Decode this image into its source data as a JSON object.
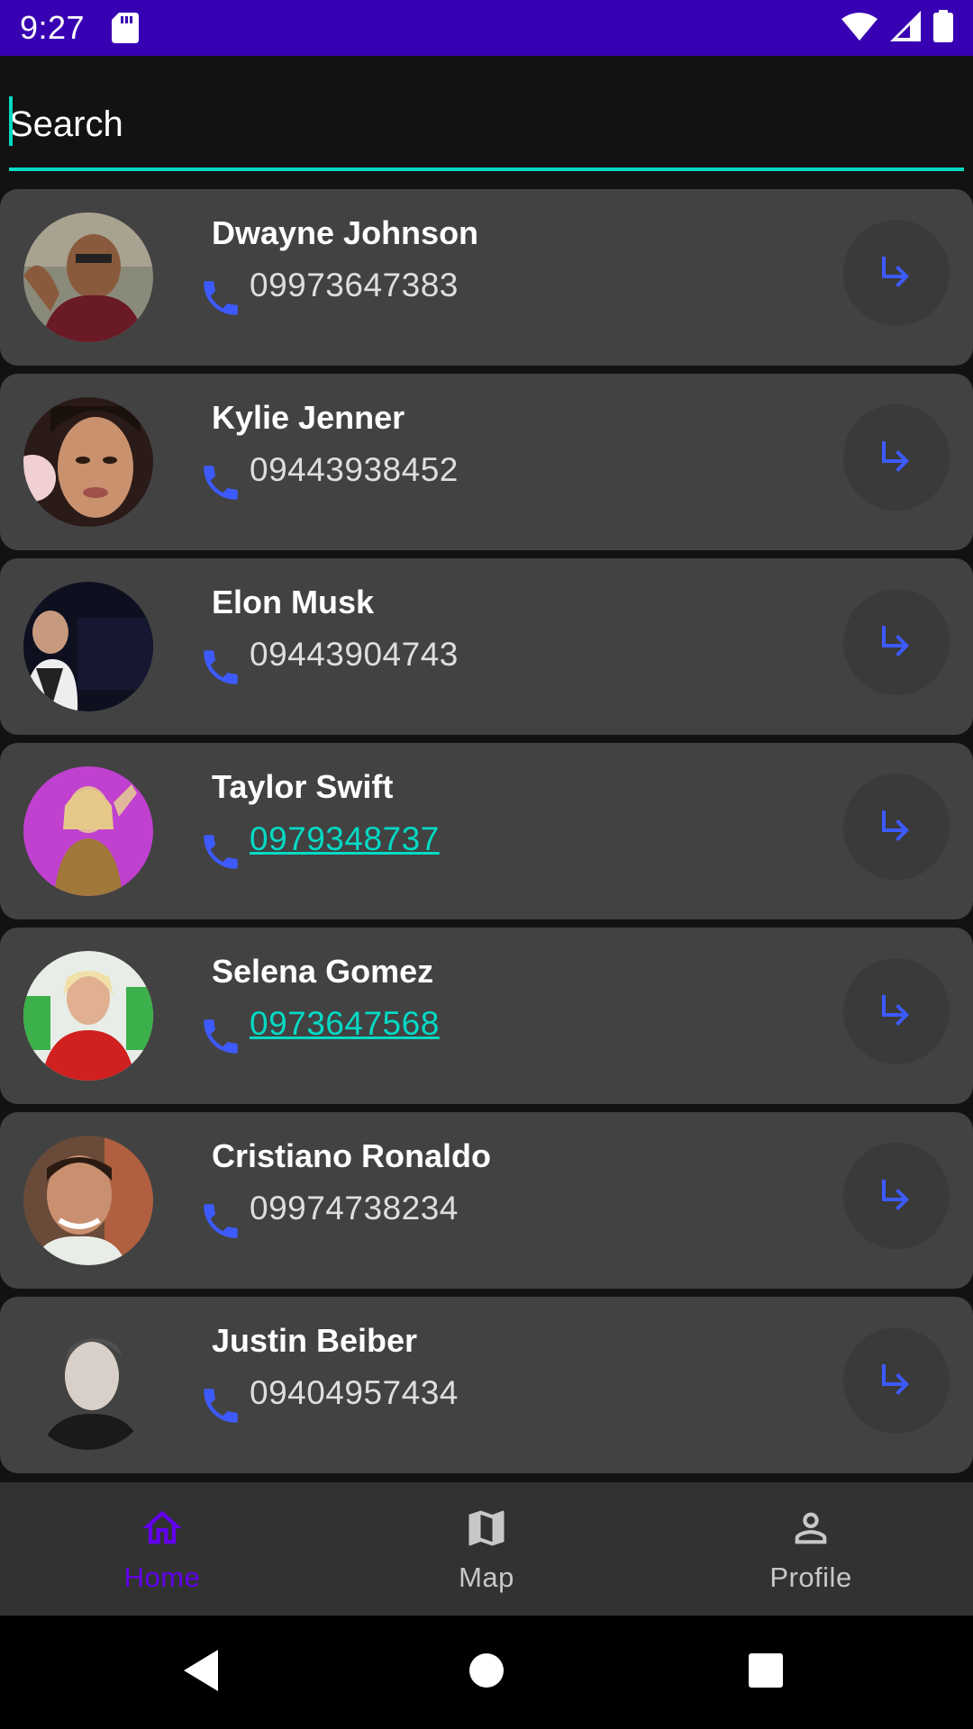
{
  "status_bar": {
    "time": "9:27",
    "icons": [
      "sd-card-icon",
      "wifi-icon",
      "signal-icon",
      "battery-icon"
    ]
  },
  "search": {
    "placeholder": "Search",
    "value": ""
  },
  "colors": {
    "accent": "#03dac5",
    "primary": "#3700b3",
    "nav_active": "#6200ee",
    "phone_icon": "#3d5afe",
    "card_bg": "#424242"
  },
  "contacts": [
    {
      "name": "Dwayne Johnson",
      "phone": "09973647383",
      "linked": false
    },
    {
      "name": "Kylie Jenner",
      "phone": "09443938452",
      "linked": false
    },
    {
      "name": "Elon Musk",
      "phone": "09443904743",
      "linked": false
    },
    {
      "name": "Taylor Swift",
      "phone": "0979348737",
      "linked": true
    },
    {
      "name": "Selena Gomez",
      "phone": "0973647568",
      "linked": true
    },
    {
      "name": "Cristiano Ronaldo",
      "phone": "09974738234",
      "linked": false
    },
    {
      "name": "Justin Beiber",
      "phone": "09404957434",
      "linked": false
    }
  ],
  "bottom_nav": {
    "items": [
      {
        "label": "Home",
        "icon": "home-icon",
        "active": true
      },
      {
        "label": "Map",
        "icon": "map-icon",
        "active": false
      },
      {
        "label": "Profile",
        "icon": "person-icon",
        "active": false
      }
    ]
  },
  "system_nav": {
    "icons": [
      "back-icon",
      "home-circle-icon",
      "recents-icon"
    ]
  }
}
